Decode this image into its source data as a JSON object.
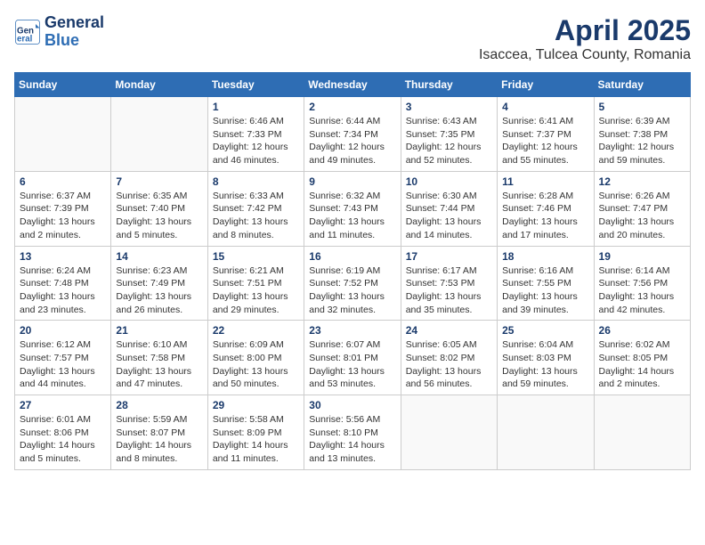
{
  "header": {
    "logo_line1": "General",
    "logo_line2": "Blue",
    "title": "April 2025",
    "subtitle": "Isaccea, Tulcea County, Romania"
  },
  "weekdays": [
    "Sunday",
    "Monday",
    "Tuesday",
    "Wednesday",
    "Thursday",
    "Friday",
    "Saturday"
  ],
  "weeks": [
    [
      {
        "day": "",
        "info": ""
      },
      {
        "day": "",
        "info": ""
      },
      {
        "day": "1",
        "info": "Sunrise: 6:46 AM\nSunset: 7:33 PM\nDaylight: 12 hours and 46 minutes."
      },
      {
        "day": "2",
        "info": "Sunrise: 6:44 AM\nSunset: 7:34 PM\nDaylight: 12 hours and 49 minutes."
      },
      {
        "day": "3",
        "info": "Sunrise: 6:43 AM\nSunset: 7:35 PM\nDaylight: 12 hours and 52 minutes."
      },
      {
        "day": "4",
        "info": "Sunrise: 6:41 AM\nSunset: 7:37 PM\nDaylight: 12 hours and 55 minutes."
      },
      {
        "day": "5",
        "info": "Sunrise: 6:39 AM\nSunset: 7:38 PM\nDaylight: 12 hours and 59 minutes."
      }
    ],
    [
      {
        "day": "6",
        "info": "Sunrise: 6:37 AM\nSunset: 7:39 PM\nDaylight: 13 hours and 2 minutes."
      },
      {
        "day": "7",
        "info": "Sunrise: 6:35 AM\nSunset: 7:40 PM\nDaylight: 13 hours and 5 minutes."
      },
      {
        "day": "8",
        "info": "Sunrise: 6:33 AM\nSunset: 7:42 PM\nDaylight: 13 hours and 8 minutes."
      },
      {
        "day": "9",
        "info": "Sunrise: 6:32 AM\nSunset: 7:43 PM\nDaylight: 13 hours and 11 minutes."
      },
      {
        "day": "10",
        "info": "Sunrise: 6:30 AM\nSunset: 7:44 PM\nDaylight: 13 hours and 14 minutes."
      },
      {
        "day": "11",
        "info": "Sunrise: 6:28 AM\nSunset: 7:46 PM\nDaylight: 13 hours and 17 minutes."
      },
      {
        "day": "12",
        "info": "Sunrise: 6:26 AM\nSunset: 7:47 PM\nDaylight: 13 hours and 20 minutes."
      }
    ],
    [
      {
        "day": "13",
        "info": "Sunrise: 6:24 AM\nSunset: 7:48 PM\nDaylight: 13 hours and 23 minutes."
      },
      {
        "day": "14",
        "info": "Sunrise: 6:23 AM\nSunset: 7:49 PM\nDaylight: 13 hours and 26 minutes."
      },
      {
        "day": "15",
        "info": "Sunrise: 6:21 AM\nSunset: 7:51 PM\nDaylight: 13 hours and 29 minutes."
      },
      {
        "day": "16",
        "info": "Sunrise: 6:19 AM\nSunset: 7:52 PM\nDaylight: 13 hours and 32 minutes."
      },
      {
        "day": "17",
        "info": "Sunrise: 6:17 AM\nSunset: 7:53 PM\nDaylight: 13 hours and 35 minutes."
      },
      {
        "day": "18",
        "info": "Sunrise: 6:16 AM\nSunset: 7:55 PM\nDaylight: 13 hours and 39 minutes."
      },
      {
        "day": "19",
        "info": "Sunrise: 6:14 AM\nSunset: 7:56 PM\nDaylight: 13 hours and 42 minutes."
      }
    ],
    [
      {
        "day": "20",
        "info": "Sunrise: 6:12 AM\nSunset: 7:57 PM\nDaylight: 13 hours and 44 minutes."
      },
      {
        "day": "21",
        "info": "Sunrise: 6:10 AM\nSunset: 7:58 PM\nDaylight: 13 hours and 47 minutes."
      },
      {
        "day": "22",
        "info": "Sunrise: 6:09 AM\nSunset: 8:00 PM\nDaylight: 13 hours and 50 minutes."
      },
      {
        "day": "23",
        "info": "Sunrise: 6:07 AM\nSunset: 8:01 PM\nDaylight: 13 hours and 53 minutes."
      },
      {
        "day": "24",
        "info": "Sunrise: 6:05 AM\nSunset: 8:02 PM\nDaylight: 13 hours and 56 minutes."
      },
      {
        "day": "25",
        "info": "Sunrise: 6:04 AM\nSunset: 8:03 PM\nDaylight: 13 hours and 59 minutes."
      },
      {
        "day": "26",
        "info": "Sunrise: 6:02 AM\nSunset: 8:05 PM\nDaylight: 14 hours and 2 minutes."
      }
    ],
    [
      {
        "day": "27",
        "info": "Sunrise: 6:01 AM\nSunset: 8:06 PM\nDaylight: 14 hours and 5 minutes."
      },
      {
        "day": "28",
        "info": "Sunrise: 5:59 AM\nSunset: 8:07 PM\nDaylight: 14 hours and 8 minutes."
      },
      {
        "day": "29",
        "info": "Sunrise: 5:58 AM\nSunset: 8:09 PM\nDaylight: 14 hours and 11 minutes."
      },
      {
        "day": "30",
        "info": "Sunrise: 5:56 AM\nSunset: 8:10 PM\nDaylight: 14 hours and 13 minutes."
      },
      {
        "day": "",
        "info": ""
      },
      {
        "day": "",
        "info": ""
      },
      {
        "day": "",
        "info": ""
      }
    ]
  ]
}
